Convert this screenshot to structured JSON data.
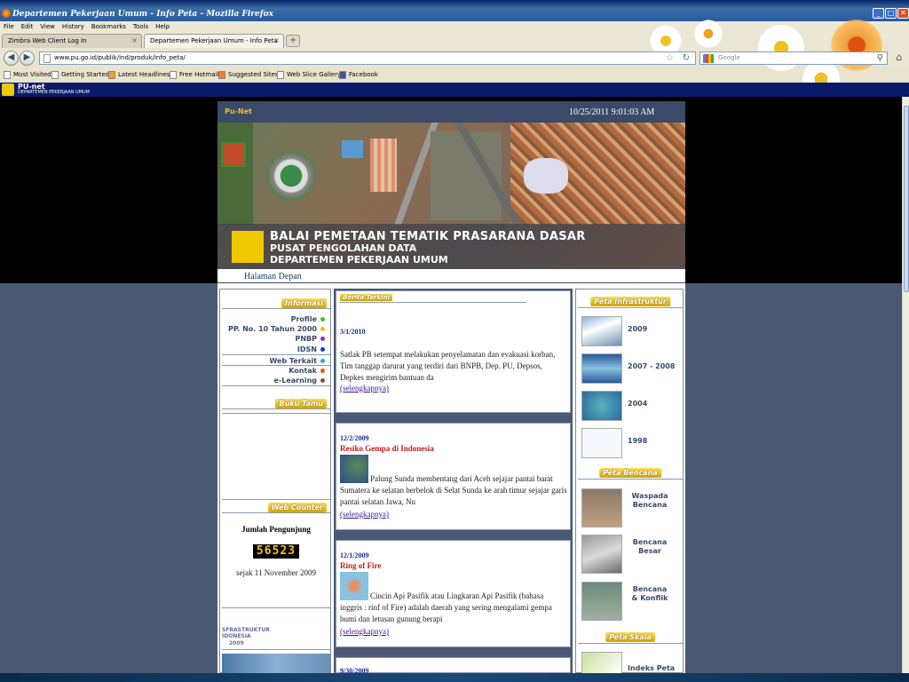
{
  "window": {
    "title": "Departemen Pekerjaan Umum - Info Peta - Mozilla Firefox"
  },
  "menu": [
    "File",
    "Edit",
    "View",
    "History",
    "Bookmarks",
    "Tools",
    "Help"
  ],
  "tabs": [
    {
      "label": "Zimbra Web Client Log In"
    },
    {
      "label": "Departemen Pekerjaan Umum - Info Peta"
    }
  ],
  "nav": {
    "url": "www.pu.go.id/publik/ind/produk/info_peta/",
    "search_placeholder": "Google"
  },
  "bookmarks": [
    "Most Visited",
    "Getting Started",
    "Latest Headlines",
    "Free Hotmail",
    "Suggested Sites",
    "Web Slice Gallery",
    "Facebook"
  ],
  "pubar": {
    "title": "PU-net",
    "subtitle": "DEPARTEMEN PEKERJAAN UMUM"
  },
  "site": {
    "brand": "Pu-Net",
    "datetime": "10/25/2011 9:01:03 AM",
    "banner": {
      "line1": "BALAI PEMETAAN TEMATIK PRASARANA DASAR",
      "line2": "PUSAT PENGOLAHAN DATA",
      "line3": "DEPARTEMEN PEKERJAAN UMUM"
    },
    "home_link": "Halaman Depan"
  },
  "left": {
    "informasi_title": "Informasi",
    "items": [
      {
        "label": "Profile",
        "color": "#3ac03a"
      },
      {
        "label": "PP. No. 10 Tahun 2000",
        "color": "#f0c000"
      },
      {
        "label": "PNBP",
        "color": "#8a2ac0"
      },
      {
        "label": "IDSN",
        "color": "#1a3ac0"
      },
      {
        "label": "Web Terkait",
        "color": "#2ab0c0"
      },
      {
        "label": "Kontak",
        "color": "#e05a1a"
      },
      {
        "label": "e-Learning",
        "color": "#8a4a2a"
      }
    ],
    "bukutamu_title": "Buku Tamu",
    "counter_title": "Web Counter",
    "visitors_label": "Jumlah Pengunjung",
    "visitors": "56523",
    "since": "sejak 11 November 2009",
    "infra_line1": "SFRASTRUKTUR",
    "infra_line2": "IDONESIA",
    "infra_line3": "2009"
  },
  "news": {
    "header": "Berita Terkini",
    "items": [
      {
        "date": "3/1/2010",
        "title": "",
        "body": "Satlak PB setempat melakukan penyelamatan dan evakuasi korban, Tim tanggap darurat yang terdiri dari BNPB, Dep. PU, Depsos, Depkes mengirim bantuan da",
        "more": "(selengkapnya)"
      },
      {
        "date": "12/2/2009",
        "title": "Resiko Gempa di Indonesia",
        "body": "Palung Sunda membentang dari Aceh sejajar pantai barat Sumatera ke selatan berbelok di Selat Sunda ke arah timur sejajar garis pantai selatan Jawa, Nu",
        "more": "(selengkapnya)"
      },
      {
        "date": "12/1/2009",
        "title": "Ring of Fire",
        "body": "Cincin Api Pasifik atau Lingkaran Api Pasifik (bahasa inggris : rinf of Fire) adalah daerah yang sering mengalami gempa bumi dan letusan gunung berapi",
        "more": "(selengkapnya)"
      },
      {
        "date": "9/30/2009"
      }
    ]
  },
  "right": {
    "infra_title": "Peta Infrastruktur",
    "infra": [
      "2009",
      "2007 - 2008",
      "2004",
      "1998"
    ],
    "bencana_title": "Peta Bencana",
    "bencana": [
      {
        "l1": "Waspada",
        "l2": "Bencana"
      },
      {
        "l1": "Bencana",
        "l2": "Besar"
      },
      {
        "l1": "Bencana",
        "l2": "& Konflik"
      }
    ],
    "skala_title": "Peta Skala",
    "skala": [
      "Indeks Peta"
    ]
  }
}
